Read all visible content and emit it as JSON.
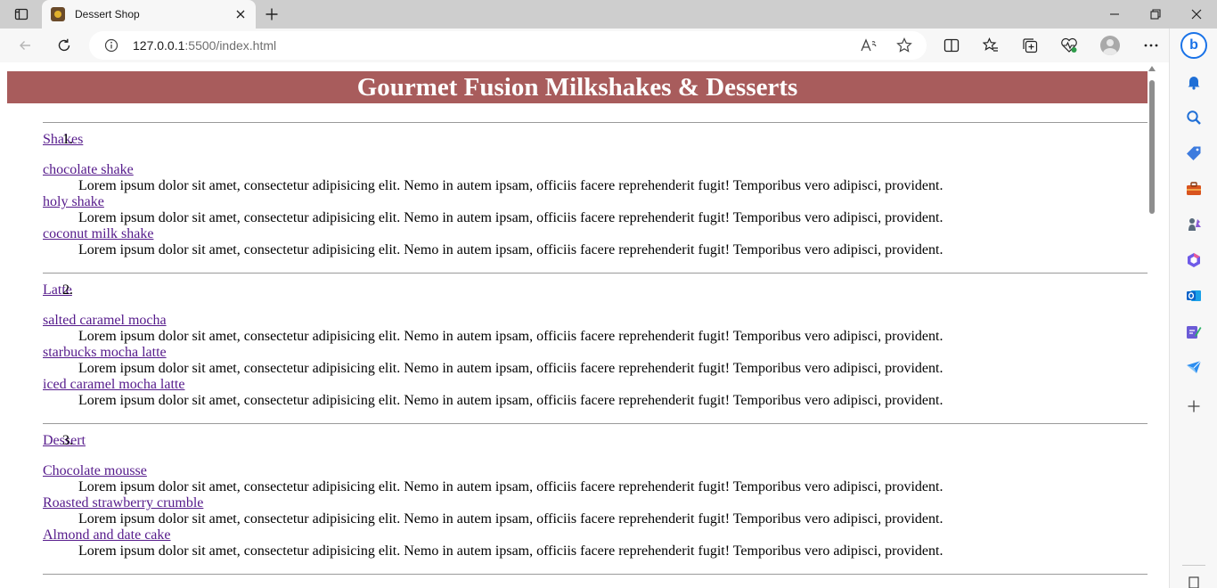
{
  "browser": {
    "tab_title": "Dessert Shop",
    "url_host": "127.0.0.1",
    "url_rest": ":5500/index.html"
  },
  "page": {
    "heading": "Gourmet Fusion Milkshakes & Desserts",
    "heading_bg": "#a85c5c",
    "link_color": "#551a8b",
    "categories": [
      {
        "number": "1.",
        "name": "Shakes",
        "items": [
          {
            "name": "chocolate shake",
            "desc": "Lorem ipsum dolor sit amet, consectetur adipisicing elit. Nemo in autem ipsam, officiis facere reprehenderit fugit! Temporibus vero adipisci, provident."
          },
          {
            "name": "holy shake",
            "desc": "Lorem ipsum dolor sit amet, consectetur adipisicing elit. Nemo in autem ipsam, officiis facere reprehenderit fugit! Temporibus vero adipisci, provident."
          },
          {
            "name": "coconut milk shake",
            "desc": "Lorem ipsum dolor sit amet, consectetur adipisicing elit. Nemo in autem ipsam, officiis facere reprehenderit fugit! Temporibus vero adipisci, provident."
          }
        ]
      },
      {
        "number": "2.",
        "name": "Latte",
        "items": [
          {
            "name": "salted caramel mocha",
            "desc": "Lorem ipsum dolor sit amet, consectetur adipisicing elit. Nemo in autem ipsam, officiis facere reprehenderit fugit! Temporibus vero adipisci, provident."
          },
          {
            "name": "starbucks mocha latte",
            "desc": "Lorem ipsum dolor sit amet, consectetur adipisicing elit. Nemo in autem ipsam, officiis facere reprehenderit fugit! Temporibus vero adipisci, provident."
          },
          {
            "name": "iced caramel mocha latte",
            "desc": "Lorem ipsum dolor sit amet, consectetur adipisicing elit. Nemo in autem ipsam, officiis facere reprehenderit fugit! Temporibus vero adipisci, provident."
          }
        ]
      },
      {
        "number": "3.",
        "name": "Dessert",
        "items": [
          {
            "name": "Chocolate mousse",
            "desc": "Lorem ipsum dolor sit amet, consectetur adipisicing elit. Nemo in autem ipsam, officiis facere reprehenderit fugit! Temporibus vero adipisci, provident."
          },
          {
            "name": "Roasted strawberry crumble",
            "desc": "Lorem ipsum dolor sit amet, consectetur adipisicing elit. Nemo in autem ipsam, officiis facere reprehenderit fugit! Temporibus vero adipisci, provident."
          },
          {
            "name": "Almond and date cake",
            "desc": "Lorem ipsum dolor sit amet, consectetur adipisicing elit. Nemo in autem ipsam, officiis facere reprehenderit fugit! Temporibus vero adipisci, provident."
          }
        ]
      }
    ]
  },
  "icons": {
    "tab_actions": "tab-actions-icon",
    "close_tab": "close-icon",
    "new_tab": "plus-icon",
    "back": "back-arrow-icon",
    "refresh": "refresh-icon",
    "site_info": "info-icon",
    "read_aloud": "read-aloud-icon",
    "favorite": "star-icon",
    "split_screen": "split-screen-icon",
    "favorites": "favorites-icon",
    "collections": "collections-icon",
    "performance": "heartbeat-icon",
    "profile": "profile-avatar-icon",
    "more": "more-icon",
    "bing": "bing-icon",
    "notifications": "bell-icon",
    "search": "search-icon",
    "shopping": "tag-icon",
    "tools": "toolbox-icon",
    "games": "chess-icon",
    "office": "office-icon",
    "outlook": "outlook-icon",
    "designer": "designer-icon",
    "send": "paper-plane-icon",
    "add": "plus-icon"
  }
}
